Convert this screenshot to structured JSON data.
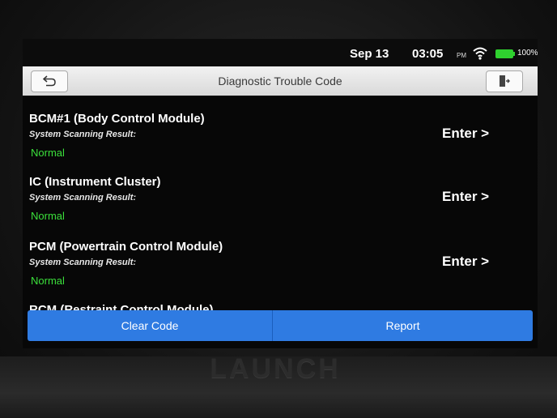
{
  "status_bar": {
    "date": "Sep 13",
    "time": "03:05",
    "ampm": "PM",
    "battery": "100%",
    "wifi_icon": "wifi-icon",
    "battery_icon": "battery-icon"
  },
  "title_bar": {
    "title": "Diagnostic Trouble Code",
    "back_icon": "back-arrow-icon",
    "exit_icon": "exit-icon"
  },
  "modules": [
    {
      "name": "BCM#1 (Body Control Module)",
      "scan_label": "System Scanning Result:",
      "status": "Normal",
      "action": "Enter >"
    },
    {
      "name": "IC (Instrument Cluster)",
      "scan_label": "System Scanning Result:",
      "status": "Normal",
      "action": "Enter >"
    },
    {
      "name": "PCM (Powertrain Control Module)",
      "scan_label": "System Scanning Result:",
      "status": "Normal",
      "action": "Enter >"
    },
    {
      "name": "RCM (Restraint Control Module)"
    }
  ],
  "actions": {
    "clear_code": "Clear Code",
    "report": "Report"
  },
  "device": {
    "brand": "LAUNCH"
  },
  "colors": {
    "accent": "#2f7be2",
    "status_normal": "#3be03b",
    "title_bar": "#e6e6e6"
  }
}
